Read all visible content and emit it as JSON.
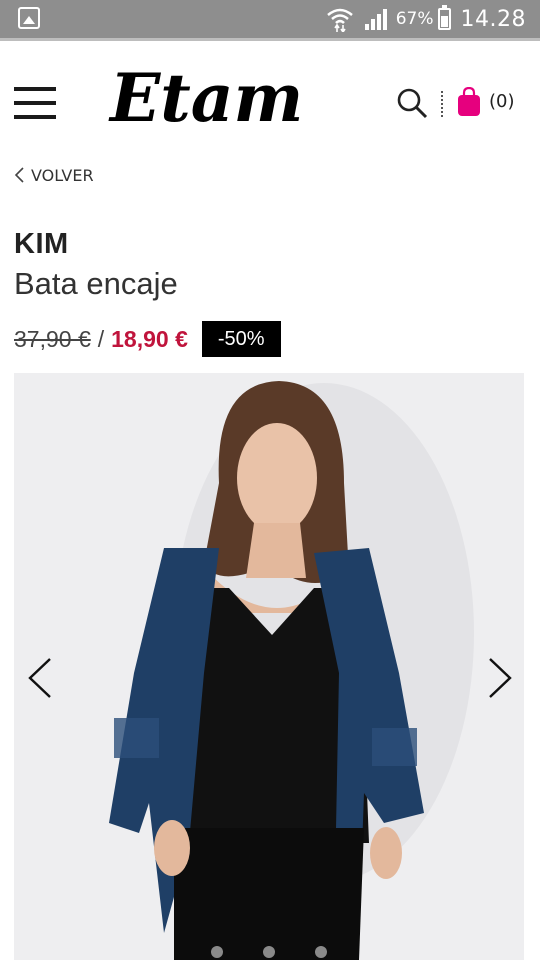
{
  "status_bar": {
    "battery_percent": "67%",
    "time": "14.28",
    "icons": [
      "gallery-icon",
      "wifi-icon",
      "signal-icon",
      "battery-icon"
    ]
  },
  "header": {
    "logo_text": "Etam",
    "cart_count": "(0)",
    "icons": [
      "menu-icon",
      "search-icon",
      "shopping-bag-icon"
    ]
  },
  "nav": {
    "back_label": "VOLVER"
  },
  "product": {
    "brand": "KIM",
    "name": "Bata encaje",
    "old_price": "37,90 €",
    "separator": "/",
    "new_price": "18,90 €",
    "discount": "-50%"
  },
  "gallery": {
    "image_subject": "model wearing navy lace kimono robe over black top and lace shorts",
    "slide_count": 3,
    "colors": {
      "background": "#eeeef0",
      "robe": "#1f3f66",
      "top": "#111111"
    }
  },
  "colors": {
    "accent_price": "#c0143c",
    "cart_bag": "#e6007e",
    "statusbar": "#8e8e8e"
  }
}
